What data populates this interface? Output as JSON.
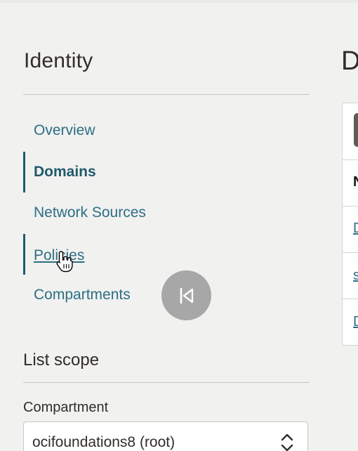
{
  "sidebar": {
    "title": "Identity",
    "nav": [
      {
        "label": "Overview",
        "state": "default"
      },
      {
        "label": "Domains",
        "state": "active"
      },
      {
        "label": "Network Sources",
        "state": "default"
      },
      {
        "label": "Policies",
        "state": "hover"
      },
      {
        "label": "Compartments",
        "state": "default"
      }
    ],
    "list_scope": {
      "title": "List scope",
      "compartment_label": "Compartment",
      "compartment_value": "ocifoundations8 (root)"
    }
  },
  "main": {
    "title_visible": "D",
    "table_header_visible": "N",
    "row_links_visible": [
      "D",
      "s",
      "D"
    ]
  },
  "overlay": {
    "rewind_icon": "skip-back-icon",
    "cursor_icon": "hand-pointer-icon"
  },
  "colors": {
    "background": "#f1f1f0",
    "link": "#2c6e84",
    "active": "#1f5a6c",
    "text": "#312d2a"
  }
}
